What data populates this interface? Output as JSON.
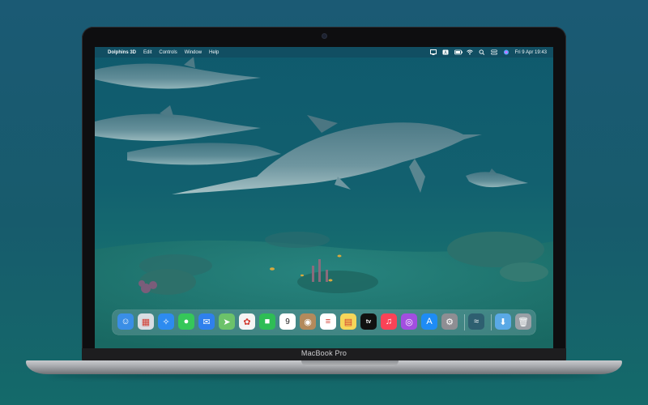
{
  "device": {
    "label": "MacBook Pro"
  },
  "menubar": {
    "app_name": "Dolphins 3D",
    "menus": [
      "Edit",
      "Controls",
      "Window",
      "Help"
    ],
    "clock": "Fri 9 Apr  19:43"
  },
  "dock": {
    "apps": [
      {
        "name": "Finder",
        "color": "#3a8ee6",
        "glyph": "☺"
      },
      {
        "name": "Launchpad",
        "color": "#d9dde3",
        "glyph": "▦"
      },
      {
        "name": "Safari",
        "color": "#2d8bf0",
        "glyph": "✧"
      },
      {
        "name": "Messages",
        "color": "#35c759",
        "glyph": "●"
      },
      {
        "name": "Mail",
        "color": "#2f80ed",
        "glyph": "✉"
      },
      {
        "name": "Maps",
        "color": "#6cc26a",
        "glyph": "➤"
      },
      {
        "name": "Photos",
        "color": "#f4f4f4",
        "glyph": "✿"
      },
      {
        "name": "FaceTime",
        "color": "#2ebd55",
        "glyph": "■"
      },
      {
        "name": "Calendar",
        "color": "#ffffff",
        "glyph": "9"
      },
      {
        "name": "Contacts",
        "color": "#b38a5c",
        "glyph": "◉"
      },
      {
        "name": "Reminders",
        "color": "#ffffff",
        "glyph": "≡"
      },
      {
        "name": "Notes",
        "color": "#f6d65a",
        "glyph": "▤"
      },
      {
        "name": "TV",
        "color": "#111111",
        "glyph": "tv"
      },
      {
        "name": "Music",
        "color": "#fa4357",
        "glyph": "♫"
      },
      {
        "name": "Podcasts",
        "color": "#a24ee0",
        "glyph": "◎"
      },
      {
        "name": "App Store",
        "color": "#1e8cf5",
        "glyph": "A"
      },
      {
        "name": "System Preferences",
        "color": "#8e8e93",
        "glyph": "⚙"
      },
      {
        "name": "Dolphins 3D",
        "color": "#2e5f70",
        "glyph": "≈"
      },
      {
        "name": "Downloads",
        "color": "#5aa9e6",
        "glyph": "⬇"
      },
      {
        "name": "Trash",
        "color": "#9aa0a6",
        "glyph": "🗑"
      }
    ]
  }
}
